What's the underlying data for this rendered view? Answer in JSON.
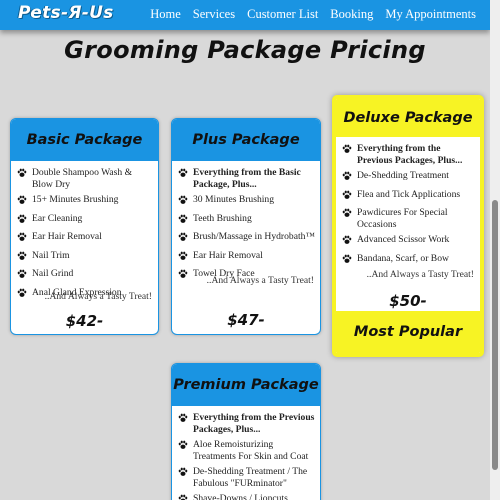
{
  "header": {
    "logo": "Pets-Я-Us",
    "nav": [
      "Home",
      "Services",
      "Customer List",
      "Booking",
      "My Appointments"
    ]
  },
  "page_title": "Grooming Package Pricing",
  "packages": {
    "basic": {
      "title": "Basic Package",
      "items": [
        "Double Shampoo Wash & Blow Dry",
        "15+ Minutes Brushing",
        "Ear Cleaning",
        "Ear Hair Removal",
        "Nail Trim",
        "Nail Grind",
        "Anal Gland Expression"
      ],
      "treat": "..And Always a Tasty Treat!",
      "price": "$42-"
    },
    "plus": {
      "title": "Plus Package",
      "items": [
        "Everything from the Basic Package, Plus...",
        "30 Minutes Brushing",
        "Teeth Brushing",
        "Brush/Massage in Hydrobath™",
        "Ear Hair Removal",
        "Towel Dry Face"
      ],
      "treat": "..And Always a Tasty Treat!",
      "price": "$47-"
    },
    "deluxe": {
      "title": "Deluxe Package",
      "items": [
        "Everything from the Previous Packages, Plus...",
        "De-Shedding Treatment",
        "Flea and Tick Applications",
        "Pawdicures For Special Occasions",
        "Advanced Scissor Work",
        "Bandana, Scarf, or Bow"
      ],
      "treat": "..And Always a Tasty Treat!",
      "price": "$50-",
      "badge": "Most Popular"
    },
    "premium": {
      "title": "Premium Package",
      "items": [
        "Everything from the Previous Packages, Plus...",
        "Aloe Remoisturizing Treatments For Skin and Coat",
        "De-Shedding Treatment / The Fabulous \"FURminator\"",
        "Shave-Downs / Lioncuts"
      ]
    }
  },
  "colors": {
    "primary": "#1a94e2",
    "highlight": "#f7f324",
    "background": "#d9d9d9"
  },
  "icons": {
    "list_bullet": "paw-icon"
  }
}
